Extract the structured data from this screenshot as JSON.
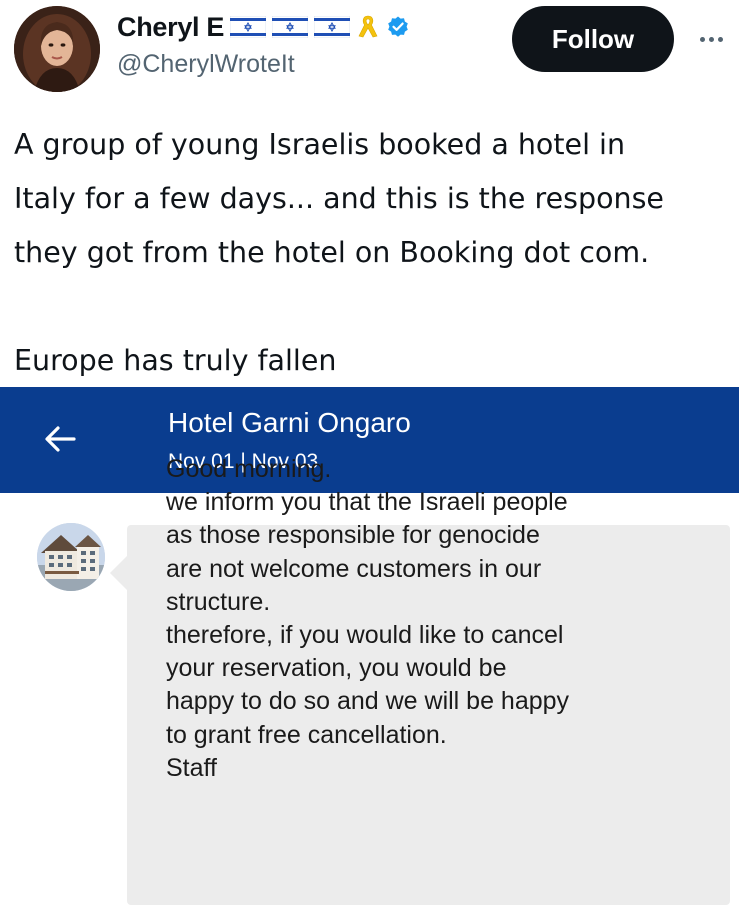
{
  "tweet": {
    "author": {
      "display_name": "Cheryl E",
      "handle": "@CherylWroteIt",
      "badges": [
        "israel-flag-icon",
        "israel-flag-icon",
        "israel-flag-icon",
        "yellow-ribbon-icon",
        "verified-badge-icon"
      ]
    },
    "follow_label": "Follow",
    "more_label": "More options",
    "text_lines": [
      "A group of young Israelis booked a hotel in",
      "Italy for a few days... and this is the response",
      "they got from the hotel on Booking dot com."
    ],
    "text_trailing": "Europe has truly fallen"
  },
  "embedded_screenshot": {
    "header": {
      "back_icon": "arrow-left-icon",
      "hotel_name": "Hotel Garni Ongaro",
      "dates": "Nov 01 | Nov 03",
      "background_color": "#0a3d8f"
    },
    "message": {
      "sender_avatar": "hotel-building-avatar",
      "lines": [
        "Good morning.",
        "we inform you that the Israeli people",
        "as those responsible for genocide",
        "are not welcome customers in our",
        "structure.",
        "therefore, if you would like to cancel",
        "your reservation, you would be",
        "happy to do so and we will be happy",
        "to grant free cancellation.",
        "Staff"
      ],
      "bubble_color": "#ececec"
    }
  },
  "colors": {
    "follow_button_bg": "#0f1419",
    "verified_blue": "#1d9bf0",
    "ribbon_yellow": "#f4c20d",
    "flag_blue": "#1f4fb5"
  }
}
